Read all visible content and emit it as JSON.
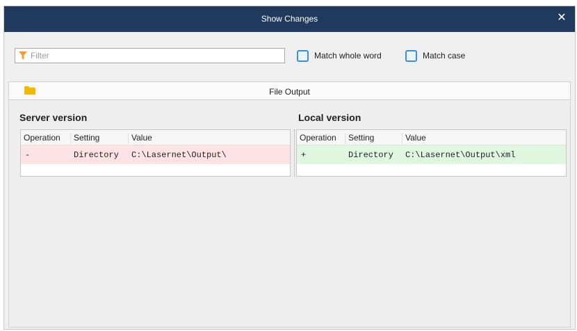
{
  "window": {
    "title": "Show Changes",
    "close_glyph": "✕"
  },
  "filter": {
    "placeholder": "Filter",
    "value": ""
  },
  "options": {
    "match_whole_word": {
      "label": "Match whole word",
      "checked": false
    },
    "match_case": {
      "label": "Match case",
      "checked": false
    }
  },
  "section": {
    "title": "File Output",
    "icon": "folder-icon"
  },
  "server": {
    "title": "Server version",
    "columns": [
      "Operation",
      "Setting",
      "Value"
    ],
    "rows": [
      {
        "operation": "-",
        "setting": "Directory",
        "value": "C:\\Lasernet\\Output\\"
      }
    ]
  },
  "local": {
    "title": "Local version",
    "columns": [
      "Operation",
      "Setting",
      "Value"
    ],
    "rows": [
      {
        "operation": "+",
        "setting": "Directory",
        "value": "C:\\Lasernet\\Output\\xml"
      }
    ]
  },
  "colors": {
    "titlebar": "#1f3a5c",
    "removed_row": "#fde3e3",
    "added_row": "#dff6df",
    "checkbox_accent": "#3a8fd9",
    "folder": "#f5b800",
    "filter_icon": "#f0a030"
  }
}
